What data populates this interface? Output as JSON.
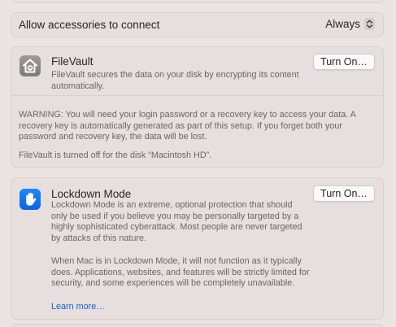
{
  "accessories": {
    "label": "Allow accessories to connect",
    "value": "Always",
    "icon": "up-down-chevron-icon"
  },
  "filevault": {
    "icon": "house-lock-icon",
    "title": "FileVault",
    "description": "FileVault secures the data on your disk by encrypting its content automatically.",
    "button_label": "Turn On…",
    "warning": "WARNING: You will need your login password or a recovery key to access your data. A recovery key is automatically generated as part of this setup. If you forget both your password and recovery key, the data will be lost.",
    "status": "FileVault is turned off for the disk “Macintosh HD”."
  },
  "lockdown": {
    "icon": "hand-raised-icon",
    "title": "Lockdown Mode",
    "description": "Lockdown Mode is an extreme, optional protection that should only be used if you believe you may be personally targeted by a highly sophisticated cyberattack. Most people are never targeted by attacks of this nature.",
    "description2": "When Mac is in Lockdown Mode, it will not function as it typically does. Applications, websites, and features will be strictly limited for security, and some experiences will be completely unavailable.",
    "link_label": "Learn more…",
    "button_label": "Turn On…"
  },
  "colors": {
    "background": "#ece4e2",
    "card": "#e6dfdd",
    "link": "#1a5fd0",
    "lockdown_icon": "#0a66e0"
  }
}
